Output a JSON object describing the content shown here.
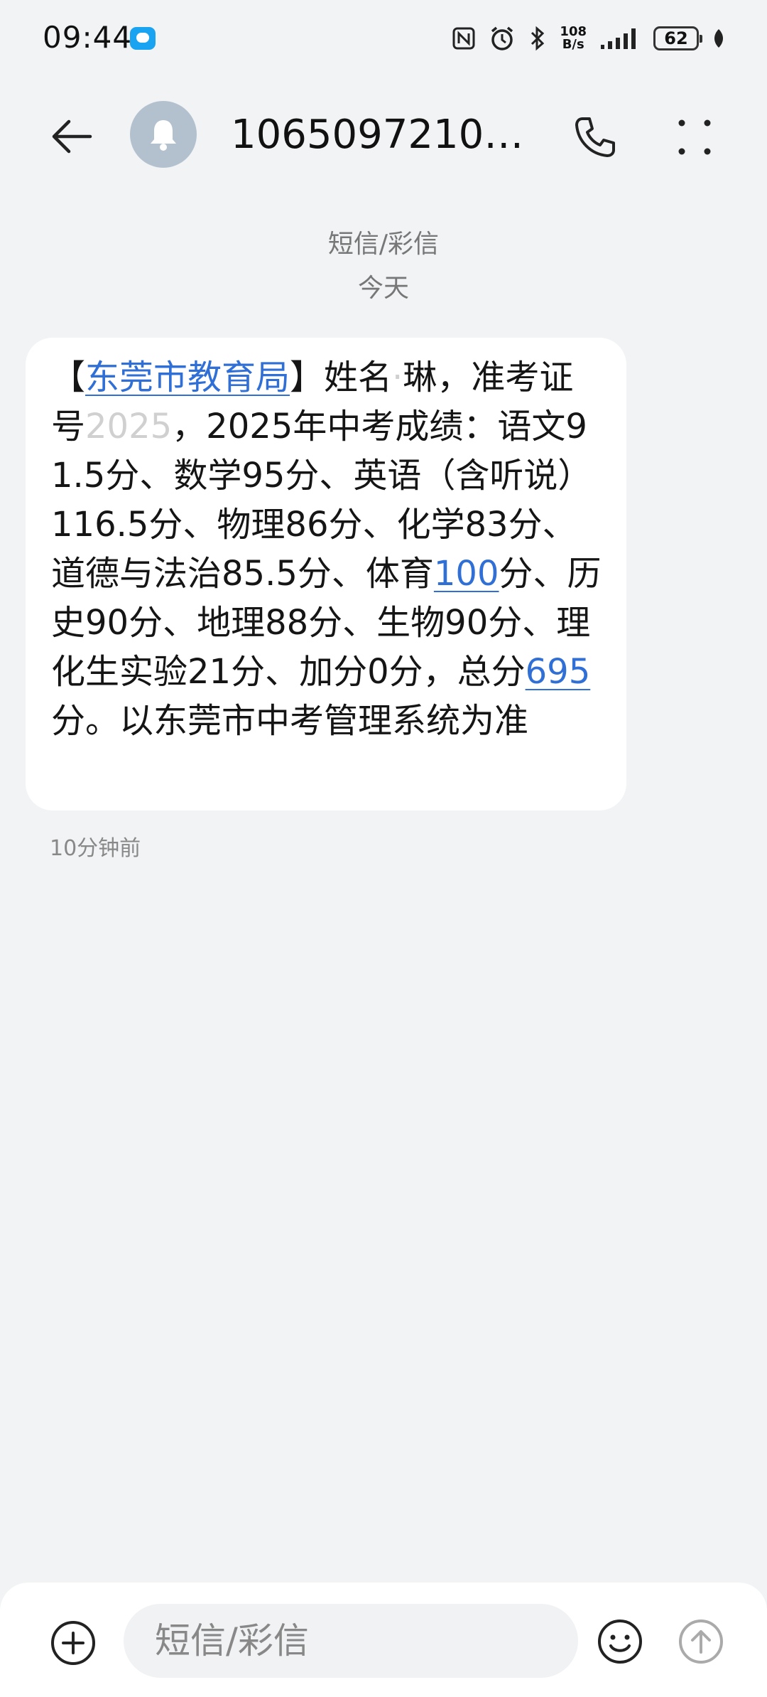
{
  "status_bar": {
    "time": "09:44",
    "net_speed_value": "108",
    "net_speed_unit": "B/s",
    "battery": "62",
    "icons": [
      "message-notification-icon",
      "nfc-icon",
      "alarm-icon",
      "bluetooth-icon",
      "signal-icon",
      "battery-icon",
      "leaf-icon"
    ]
  },
  "header": {
    "title": "10650972103...",
    "icons": [
      "back-arrow-icon",
      "bell-avatar-icon",
      "phone-icon",
      "more-vertical-icon"
    ]
  },
  "conversation": {
    "type_label": "短信/彩信",
    "date_label": "今天"
  },
  "message": {
    "bracket_open": "【",
    "org_link": "东莞市教育局",
    "text_1": "】姓名",
    "redacted_name": "·",
    "text_2": "琳，准考证号",
    "redacted_id": "2025",
    "text_3": "，2025年中考成绩：语文91.5分、数学95分、英语（含听说）116.5分、物理86分、化学83分、道德与法治85.5分、体育",
    "sport_score_link": "100",
    "text_4": "分、历史90分、地理88分、生物90分、理化生实验21分、加分0分，总分",
    "total_link": "695",
    "text_5": "分。以东莞市中考管理系统为准",
    "time_ago": "10分钟前"
  },
  "input_bar": {
    "placeholder": "短信/彩信",
    "icons": [
      "add-icon",
      "emoji-icon",
      "send-icon"
    ]
  },
  "colors": {
    "background": "#f1f3f5",
    "bubble": "#ffffff",
    "link": "#2f6fd6",
    "avatar": "#b3c1cf",
    "status_msg_icon": "#1aa3f0"
  }
}
